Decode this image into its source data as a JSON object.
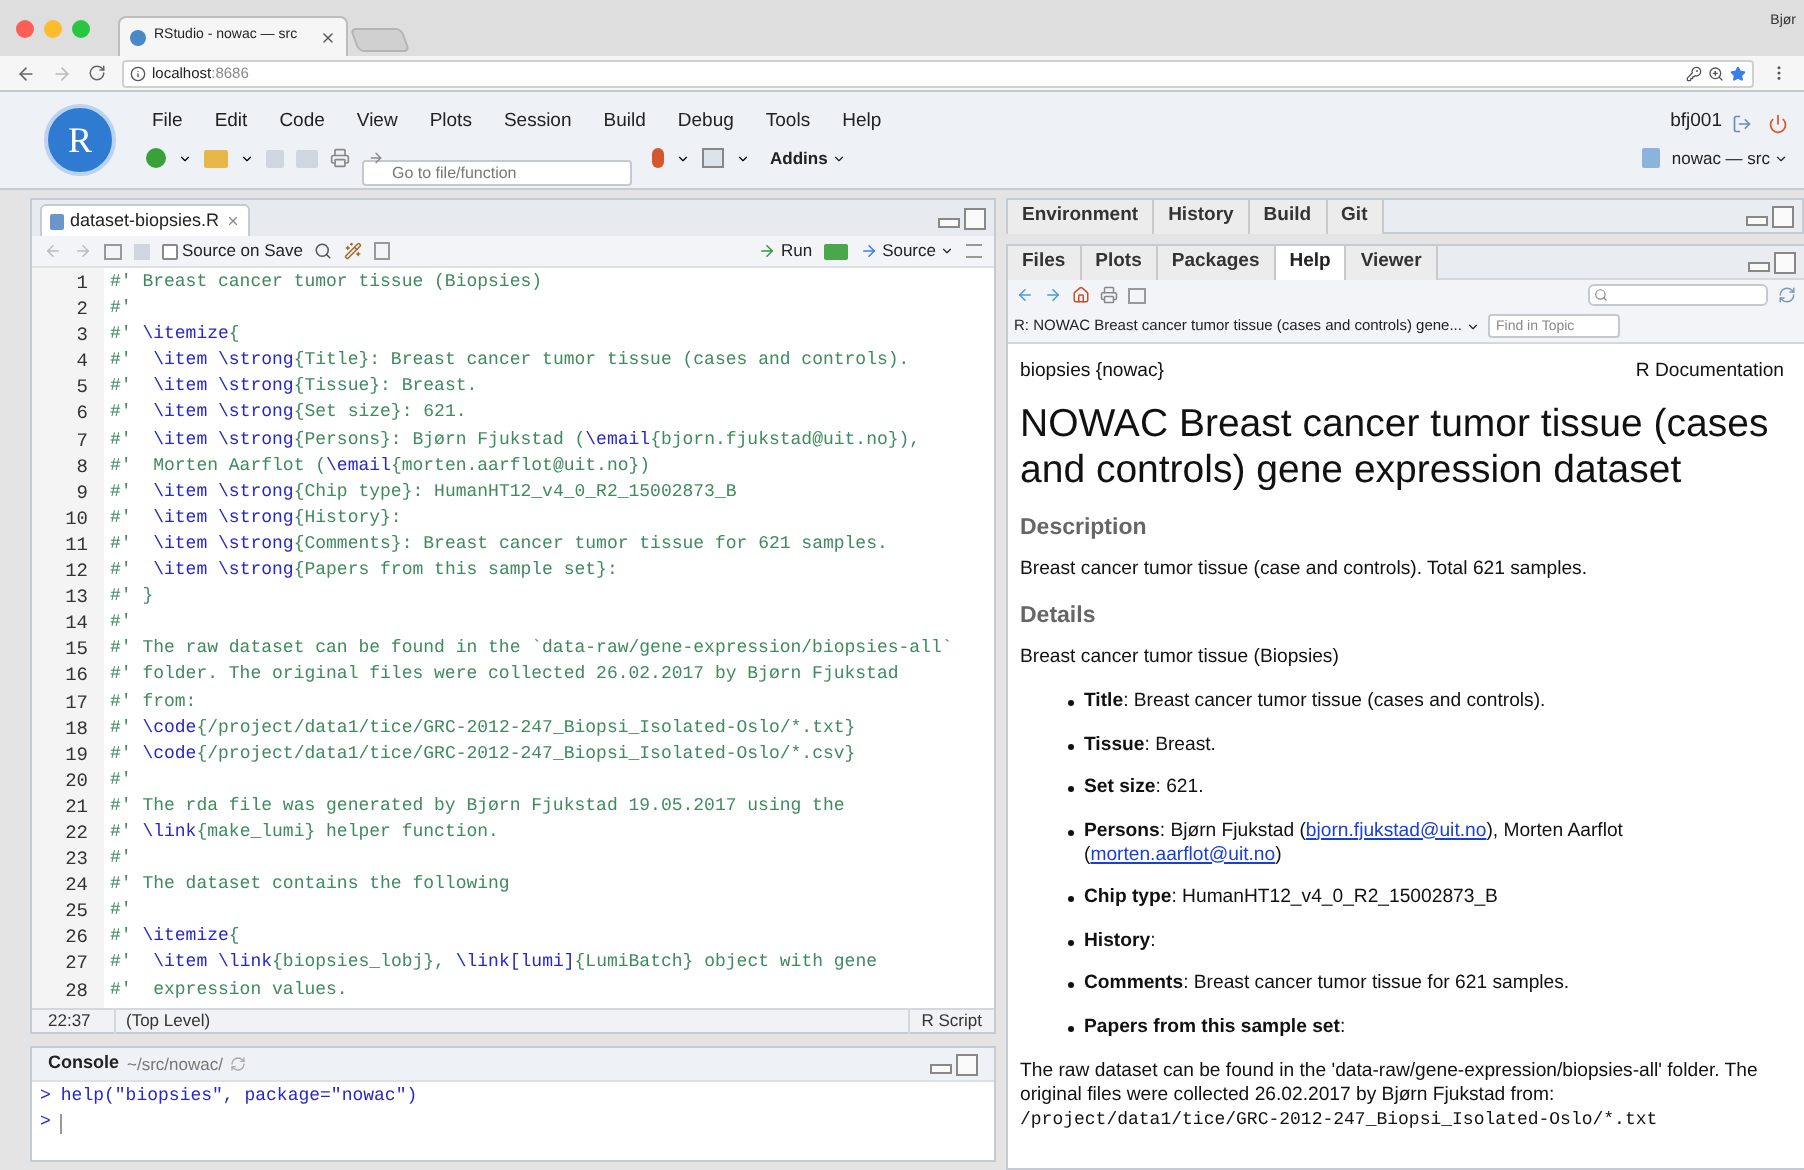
{
  "browser": {
    "tab_title": "RStudio - nowac — src",
    "profile": "Bjør",
    "url": {
      "host": "localhost",
      "port": ":8686"
    }
  },
  "app": {
    "logo_letter": "R",
    "menu": [
      "File",
      "Edit",
      "Code",
      "View",
      "Plots",
      "Session",
      "Build",
      "Debug",
      "Tools",
      "Help"
    ],
    "user": "bfj001",
    "goto_placeholder": "Go to file/function",
    "addins": "Addins",
    "project": "nowac — src"
  },
  "editor": {
    "file_tab": "dataset-biopsies.R",
    "source_on_save": {
      "label": "Source on Save",
      "checked": false
    },
    "run": "Run",
    "source": "Source",
    "lines": [
      {
        "number": "1",
        "segments": [
          {
            "kind": "comment",
            "text": "#' Breast cancer tumor tissue (Biopsies)"
          }
        ]
      },
      {
        "number": "2",
        "segments": [
          {
            "kind": "comment",
            "text": "#'"
          }
        ]
      },
      {
        "number": "3",
        "segments": [
          {
            "kind": "comment",
            "text": "#' "
          },
          {
            "kind": "keyword",
            "text": "\\itemize"
          },
          {
            "kind": "comment",
            "text": "{"
          }
        ]
      },
      {
        "number": "4",
        "segments": [
          {
            "kind": "comment",
            "text": "#'  "
          },
          {
            "kind": "keyword",
            "text": "\\item \\strong"
          },
          {
            "kind": "comment",
            "text": "{Title}: Breast cancer tumor tissue (cases and controls)."
          }
        ]
      },
      {
        "number": "5",
        "segments": [
          {
            "kind": "comment",
            "text": "#'  "
          },
          {
            "kind": "keyword",
            "text": "\\item \\strong"
          },
          {
            "kind": "comment",
            "text": "{Tissue}: Breast."
          }
        ]
      },
      {
        "number": "6",
        "segments": [
          {
            "kind": "comment",
            "text": "#'  "
          },
          {
            "kind": "keyword",
            "text": "\\item \\strong"
          },
          {
            "kind": "comment",
            "text": "{Set size}: 621."
          }
        ]
      },
      {
        "number": "7",
        "segments": [
          {
            "kind": "comment",
            "text": "#'  "
          },
          {
            "kind": "keyword",
            "text": "\\item \\strong"
          },
          {
            "kind": "comment",
            "text": "{Persons}: Bjørn Fjukstad ("
          },
          {
            "kind": "keyword",
            "text": "\\email"
          },
          {
            "kind": "comment",
            "text": "{bjorn.fjukstad@uit.no}),"
          }
        ]
      },
      {
        "number": "8",
        "segments": [
          {
            "kind": "comment",
            "text": "#'  Morten Aarflot ("
          },
          {
            "kind": "keyword",
            "text": "\\email"
          },
          {
            "kind": "comment",
            "text": "{morten.aarflot@uit.no})"
          }
        ]
      },
      {
        "number": "9",
        "segments": [
          {
            "kind": "comment",
            "text": "#'  "
          },
          {
            "kind": "keyword",
            "text": "\\item \\strong"
          },
          {
            "kind": "comment",
            "text": "{Chip type}: HumanHT12_v4_0_R2_15002873_B"
          }
        ]
      },
      {
        "number": "10",
        "segments": [
          {
            "kind": "comment",
            "text": "#'  "
          },
          {
            "kind": "keyword",
            "text": "\\item \\strong"
          },
          {
            "kind": "comment",
            "text": "{History}:"
          }
        ]
      },
      {
        "number": "11",
        "segments": [
          {
            "kind": "comment",
            "text": "#'  "
          },
          {
            "kind": "keyword",
            "text": "\\item \\strong"
          },
          {
            "kind": "comment",
            "text": "{Comments}: Breast cancer tumor tissue for 621 samples."
          }
        ]
      },
      {
        "number": "12",
        "segments": [
          {
            "kind": "comment",
            "text": "#'  "
          },
          {
            "kind": "keyword",
            "text": "\\item \\strong"
          },
          {
            "kind": "comment",
            "text": "{Papers from this sample set}:"
          }
        ]
      },
      {
        "number": "13",
        "segments": [
          {
            "kind": "comment",
            "text": "#' }"
          }
        ]
      },
      {
        "number": "14",
        "segments": [
          {
            "kind": "comment",
            "text": "#'"
          }
        ]
      },
      {
        "number": "15",
        "segments": [
          {
            "kind": "comment",
            "text": "#' The raw dataset can be found in the `data-raw/gene-expression/biopsies-all`"
          }
        ]
      },
      {
        "number": "16",
        "segments": [
          {
            "kind": "comment",
            "text": "#' folder. The original files were collected 26.02.2017 by Bjørn Fjukstad"
          }
        ]
      },
      {
        "number": "17",
        "segments": [
          {
            "kind": "comment",
            "text": "#' from:"
          }
        ]
      },
      {
        "number": "18",
        "segments": [
          {
            "kind": "comment",
            "text": "#' "
          },
          {
            "kind": "keyword",
            "text": "\\code"
          },
          {
            "kind": "comment",
            "text": "{/project/data1/tice/GRC-2012-247_Biopsi_Isolated-Oslo/*.txt}"
          }
        ]
      },
      {
        "number": "19",
        "segments": [
          {
            "kind": "comment",
            "text": "#' "
          },
          {
            "kind": "keyword",
            "text": "\\code"
          },
          {
            "kind": "comment",
            "text": "{/project/data1/tice/GRC-2012-247_Biopsi_Isolated-Oslo/*.csv}"
          }
        ]
      },
      {
        "number": "20",
        "segments": [
          {
            "kind": "comment",
            "text": "#'"
          }
        ]
      },
      {
        "number": "21",
        "segments": [
          {
            "kind": "comment",
            "text": "#' The rda file was generated by Bjørn Fjukstad 19.05.2017 using the"
          }
        ]
      },
      {
        "number": "22",
        "segments": [
          {
            "kind": "comment",
            "text": "#' "
          },
          {
            "kind": "keyword",
            "text": "\\link"
          },
          {
            "kind": "comment",
            "text": "{make_lumi} helper function."
          }
        ]
      },
      {
        "number": "23",
        "segments": [
          {
            "kind": "comment",
            "text": "#'"
          }
        ]
      },
      {
        "number": "24",
        "segments": [
          {
            "kind": "comment",
            "text": "#' The dataset contains the following"
          }
        ]
      },
      {
        "number": "25",
        "segments": [
          {
            "kind": "comment",
            "text": "#'"
          }
        ]
      },
      {
        "number": "26",
        "segments": [
          {
            "kind": "comment",
            "text": "#' "
          },
          {
            "kind": "keyword",
            "text": "\\itemize"
          },
          {
            "kind": "comment",
            "text": "{"
          }
        ]
      },
      {
        "number": "27",
        "segments": [
          {
            "kind": "comment",
            "text": "#'  "
          },
          {
            "kind": "keyword",
            "text": "\\item \\link"
          },
          {
            "kind": "comment",
            "text": "{biopsies_lobj}, "
          },
          {
            "kind": "keyword",
            "text": "\\link[lumi]"
          },
          {
            "kind": "comment",
            "text": "{LumiBatch} object with gene"
          }
        ]
      },
      {
        "number": "28",
        "segments": [
          {
            "kind": "comment",
            "text": "#'  expression values."
          }
        ]
      }
    ],
    "status": {
      "position": "22:37",
      "scope": "(Top Level)",
      "file_type": "R Script"
    }
  },
  "console": {
    "title": "Console",
    "path": "~/src/nowac/",
    "history": [
      {
        "prompt": ">",
        "command": "help(\"biopsies\", package=\"nowac\")"
      }
    ],
    "current_prompt": ">"
  },
  "upper_tabs": [
    {
      "label": "Environment",
      "selected": false
    },
    {
      "label": "History",
      "selected": false
    },
    {
      "label": "Build",
      "selected": false
    },
    {
      "label": "Git",
      "selected": false
    }
  ],
  "lower_tabs": [
    {
      "label": "Files",
      "selected": false
    },
    {
      "label": "Plots",
      "selected": false
    },
    {
      "label": "Packages",
      "selected": false
    },
    {
      "label": "Help",
      "selected": true
    },
    {
      "label": "Viewer",
      "selected": false
    }
  ],
  "help": {
    "topic": "R: NOWAC Breast cancer tumor tissue (cases and controls) gene...",
    "find_placeholder": "Find in Topic",
    "package": "biopsies {nowac}",
    "doc_label": "R Documentation",
    "title": "NOWAC Breast cancer tumor tissue (cases and controls) gene expression dataset",
    "description_heading": "Description",
    "description": "Breast cancer tumor tissue (case and controls). Total 621 samples.",
    "details_heading": "Details",
    "details_intro": "Breast cancer tumor tissue (Biopsies)",
    "items": [
      {
        "label": "Title",
        "parts": [
          {
            "kind": "text",
            "text": ": Breast cancer tumor tissue (cases and controls)."
          }
        ]
      },
      {
        "label": "Tissue",
        "parts": [
          {
            "kind": "text",
            "text": ": Breast."
          }
        ]
      },
      {
        "label": "Set size",
        "parts": [
          {
            "kind": "text",
            "text": ": 621."
          }
        ]
      },
      {
        "label": "Persons",
        "parts": [
          {
            "kind": "text",
            "text": ": Bjørn Fjukstad ("
          },
          {
            "kind": "link",
            "text": "bjorn.fjukstad@uit.no"
          },
          {
            "kind": "text",
            "text": "), Morten Aarflot ("
          },
          {
            "kind": "link",
            "text": "morten.aarflot@uit.no"
          },
          {
            "kind": "text",
            "text": ")"
          }
        ]
      },
      {
        "label": "Chip type",
        "parts": [
          {
            "kind": "text",
            "text": ": HumanHT12_v4_0_R2_15002873_B"
          }
        ]
      },
      {
        "label": "History",
        "parts": [
          {
            "kind": "text",
            "text": ":"
          }
        ]
      },
      {
        "label": "Comments",
        "parts": [
          {
            "kind": "text",
            "text": ": Breast cancer tumor tissue for 621 samples."
          }
        ]
      },
      {
        "label": "Papers from this sample set",
        "parts": [
          {
            "kind": "text",
            "text": ":"
          }
        ]
      }
    ],
    "raw_paragraph": "The raw dataset can be found in the 'data-raw/gene-expression/biopsies-all' folder. The original files were collected 26.02.2017 by Bjørn Fjukstad from:",
    "raw_path": "/project/data1/tice/GRC-2012-247_Biopsi_Isolated-Oslo/*.txt"
  }
}
